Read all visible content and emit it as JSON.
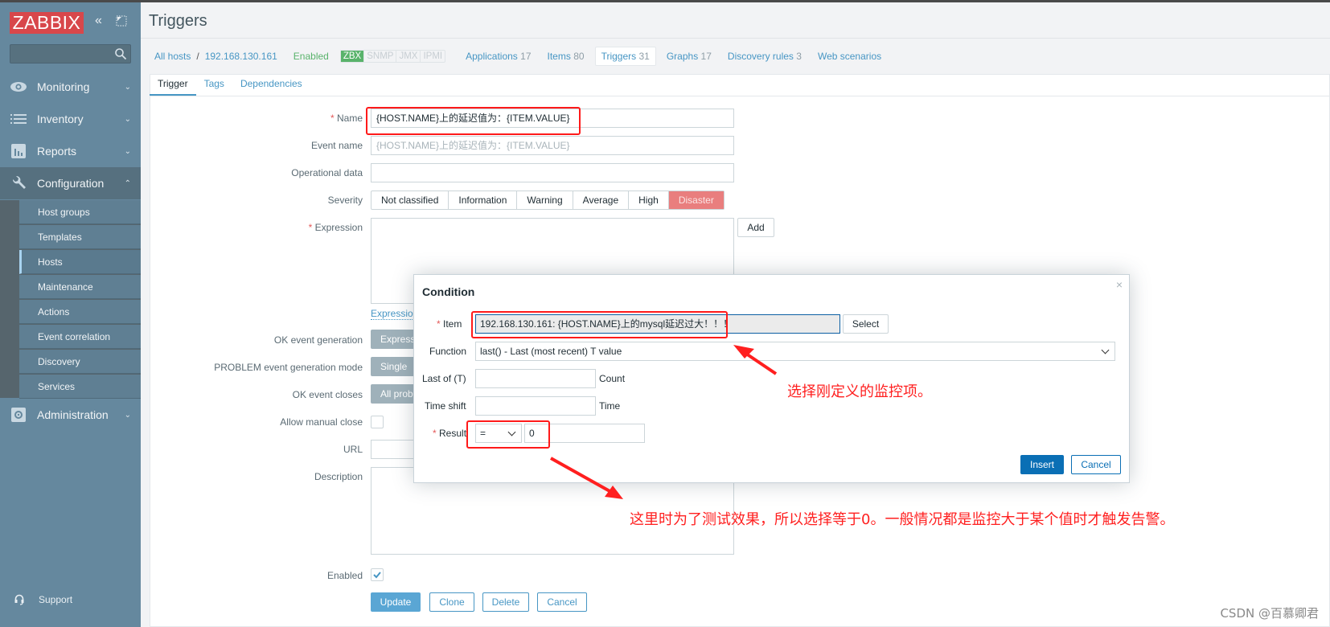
{
  "app": {
    "logo": "ZABBIX",
    "page_title": "Triggers"
  },
  "sidebar": {
    "search_placeholder": "",
    "menu": [
      {
        "label": "Monitoring",
        "icon": "eye-icon",
        "expanded": false
      },
      {
        "label": "Inventory",
        "icon": "list-icon",
        "expanded": false
      },
      {
        "label": "Reports",
        "icon": "bar-chart-icon",
        "expanded": false
      },
      {
        "label": "Configuration",
        "icon": "wrench-icon",
        "expanded": true
      },
      {
        "label": "Administration",
        "icon": "gear-icon",
        "expanded": false
      }
    ],
    "submenu": [
      {
        "label": "Host groups"
      },
      {
        "label": "Templates"
      },
      {
        "label": "Hosts",
        "selected": true
      },
      {
        "label": "Maintenance"
      },
      {
        "label": "Actions"
      },
      {
        "label": "Event correlation"
      },
      {
        "label": "Discovery"
      },
      {
        "label": "Services"
      }
    ],
    "support_label": "Support"
  },
  "breadcrumb": {
    "all_hosts": "All hosts",
    "separator": "/",
    "host": "192.168.130.161",
    "status": "Enabled",
    "availability": [
      "ZBX",
      "SNMP",
      "JMX",
      "IPMI"
    ],
    "tabs": [
      {
        "label": "Applications",
        "count": "17"
      },
      {
        "label": "Items",
        "count": "80"
      },
      {
        "label": "Triggers",
        "count": "31",
        "current": true
      },
      {
        "label": "Graphs",
        "count": "17"
      },
      {
        "label": "Discovery rules",
        "count": "3"
      },
      {
        "label": "Web scenarios",
        "count": ""
      }
    ]
  },
  "form_tabs": [
    {
      "label": "Trigger",
      "active": true
    },
    {
      "label": "Tags"
    },
    {
      "label": "Dependencies"
    }
  ],
  "form": {
    "name_label": "Name",
    "name_value": "{HOST.NAME}上的延迟值为：{ITEM.VALUE}",
    "event_name_label": "Event name",
    "event_name_placeholder": "{HOST.NAME}上的延迟值为：{ITEM.VALUE}",
    "operational_data_label": "Operational data",
    "operational_data_value": "",
    "severity_label": "Severity",
    "severity_options": [
      "Not classified",
      "Information",
      "Warning",
      "Average",
      "High",
      "Disaster"
    ],
    "severity_selected": "Disaster",
    "expression_label": "Expression",
    "expression_value": "",
    "add_button": "Add",
    "expression_constructor_link": "Expression constructor",
    "ok_event_generation_label": "OK event generation",
    "ok_event_generation_value": "Expression",
    "problem_mode_label": "PROBLEM event generation mode",
    "problem_mode_value": "Single",
    "ok_event_closes_label": "OK event closes",
    "ok_event_closes_value": "All problems",
    "allow_manual_close_label": "Allow manual close",
    "allow_manual_close": false,
    "url_label": "URL",
    "url_value": "",
    "description_label": "Description",
    "description_value": "",
    "enabled_label": "Enabled",
    "enabled": true,
    "buttons": {
      "update": "Update",
      "clone": "Clone",
      "delete": "Delete",
      "cancel": "Cancel"
    }
  },
  "dialog": {
    "title": "Condition",
    "close_symbol": "×",
    "item_label": "Item",
    "item_value": "192.168.130.161: {HOST.NAME}上的mysql延迟过大！！！",
    "select_button": "Select",
    "function_label": "Function",
    "function_value": "last() - Last (most recent) T value",
    "last_of_label": "Last of (T)",
    "last_of_value": "",
    "last_of_unit": "Count",
    "time_shift_label": "Time shift",
    "time_shift_value": "",
    "time_shift_unit": "Time",
    "result_label": "Result",
    "result_operator": "=",
    "result_value": "0",
    "insert_button": "Insert",
    "cancel_button": "Cancel"
  },
  "annotations": {
    "item_note": "选择刚定义的监控项。",
    "result_note": "这里时为了测试效果，所以选择等于0。一般情况都是监控大于某个值时才触发告警。",
    "color": "#ff1f1f"
  },
  "watermark": "CSDN @百慕卿君",
  "colors": {
    "sidebar": "#65889e",
    "logo": "#d8474b",
    "link": "#4796c4",
    "enabled": "#59b36b",
    "disaster": "#e97e7e",
    "primary_button": "#5aa6d4",
    "insert_button": "#0a6fb5"
  }
}
